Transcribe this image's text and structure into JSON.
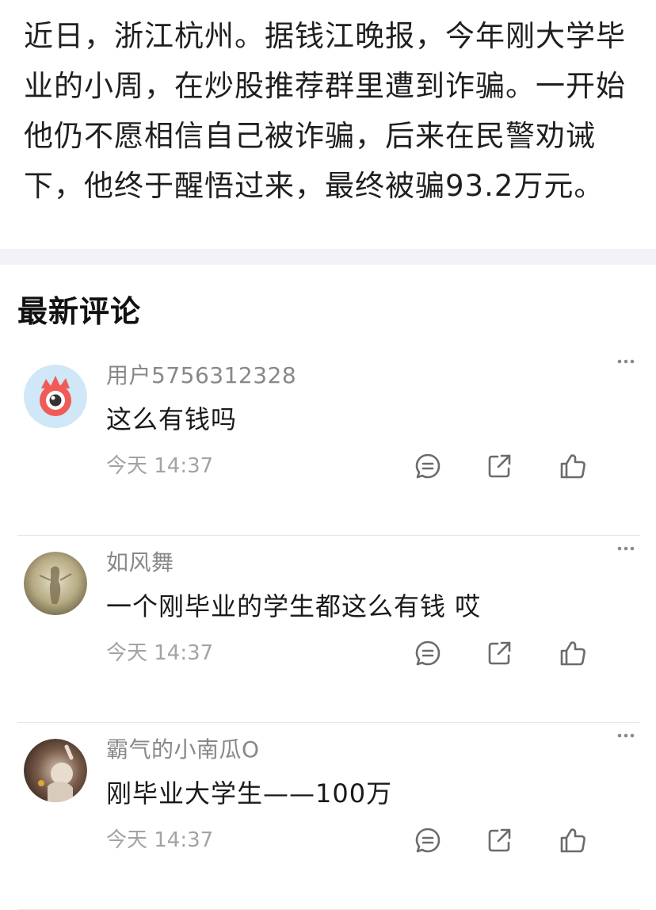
{
  "article": {
    "text": "近日，浙江杭州。据钱江晚报，今年刚大学毕业的小周，在炒股推荐群里遭到诈骗。一开始他仍不愿相信自己被诈骗，后来在民警劝诫下，他终于醒悟过来，最终被骗93.2万元。"
  },
  "comments_section": {
    "title": "最新评论",
    "comments": [
      {
        "username": "用户5756312328",
        "content": "这么有钱吗",
        "time": "今天 14:37",
        "avatar_icon": "weibo-default-avatar-icon"
      },
      {
        "username": "如风舞",
        "content": "一个刚毕业的学生都这么有钱 哎",
        "time": "今天 14:37",
        "avatar_icon": "user-photo-avatar"
      },
      {
        "username": "霸气的小南瓜O",
        "content": "刚毕业大学生——100万",
        "time": "今天 14:37",
        "avatar_icon": "user-photo-avatar"
      }
    ],
    "action_icons": [
      "more-icon",
      "comment-icon",
      "share-icon",
      "like-icon"
    ]
  },
  "colors": {
    "divider_band": "#f2f3f7",
    "username": "#888888",
    "time": "#a3a3a3",
    "icon": "#6b6b6b",
    "avatar_red": "#f05a57",
    "avatar_blue": "#cfe7f7"
  }
}
